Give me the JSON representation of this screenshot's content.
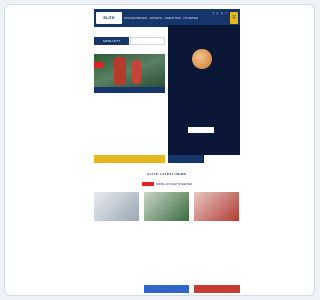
{
  "header": {
    "logo_text": "ELITE",
    "nav_text": "HOCKEYBANDS · SPORTS · OMFATTER · NYHETER",
    "icons_text": "f y o ⌕",
    "menu_icon": "≡"
  },
  "left_panel": {
    "title": "SISTE NYTT",
    "tab1": "",
    "tab2": "",
    "hero_badge": "",
    "list": [
      {
        "title": "",
        "sub": ""
      },
      {
        "title": "",
        "sub": ""
      },
      {
        "title": "",
        "sub": ""
      }
    ],
    "button": ""
  },
  "video_panel": {
    "caption": "",
    "tab1": "",
    "tab2": ""
  },
  "latest": {
    "heading": "ELITE LATEST NEWS",
    "tags": ""
  },
  "section": {
    "label": "SISTE HOCKEYNYHETER"
  },
  "cards": [
    {
      "caption": ""
    },
    {
      "caption": ""
    },
    {
      "caption": ""
    }
  ],
  "colors": {
    "primary": "#16356b",
    "accent": "#e5b81e",
    "alert": "#dd2222"
  }
}
